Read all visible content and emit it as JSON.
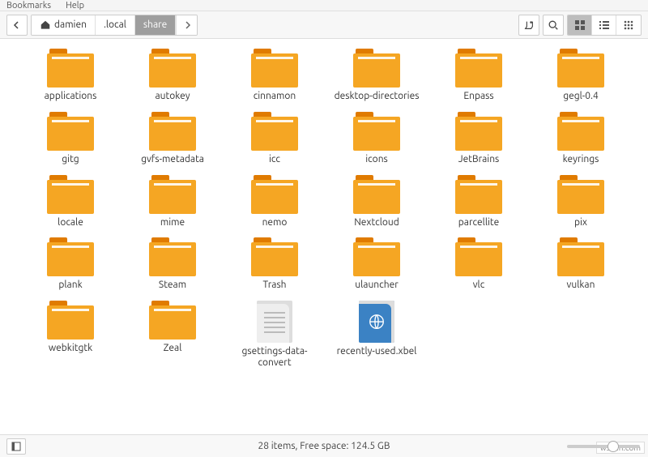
{
  "menubar": {
    "item1": "Bookmarks",
    "item2": "Help"
  },
  "path": {
    "home_label": "damien",
    "seg_local": ".local",
    "seg_share": "share"
  },
  "items": [
    {
      "type": "folder",
      "label": "applications"
    },
    {
      "type": "folder",
      "label": "autokey"
    },
    {
      "type": "folder",
      "label": "cinnamon"
    },
    {
      "type": "folder",
      "label": "desktop-directories"
    },
    {
      "type": "folder",
      "label": "Enpass"
    },
    {
      "type": "folder",
      "label": "gegl-0.4"
    },
    {
      "type": "folder",
      "label": "gitg"
    },
    {
      "type": "folder",
      "label": "gvfs-metadata"
    },
    {
      "type": "folder",
      "label": "icc"
    },
    {
      "type": "folder",
      "label": "icons"
    },
    {
      "type": "folder",
      "label": "JetBrains"
    },
    {
      "type": "folder",
      "label": "keyrings"
    },
    {
      "type": "folder",
      "label": "locale"
    },
    {
      "type": "folder",
      "label": "mime"
    },
    {
      "type": "folder",
      "label": "nemo"
    },
    {
      "type": "folder",
      "label": "Nextcloud"
    },
    {
      "type": "folder",
      "label": "parcellite"
    },
    {
      "type": "folder",
      "label": "pix"
    },
    {
      "type": "folder",
      "label": "plank"
    },
    {
      "type": "folder",
      "label": "Steam"
    },
    {
      "type": "folder",
      "label": "Trash"
    },
    {
      "type": "folder",
      "label": "ulauncher"
    },
    {
      "type": "folder",
      "label": "vlc"
    },
    {
      "type": "folder",
      "label": "vulkan"
    },
    {
      "type": "folder",
      "label": "webkitgtk"
    },
    {
      "type": "folder",
      "label": "Zeal"
    },
    {
      "type": "file-text",
      "label": "gsettings-data-convert"
    },
    {
      "type": "file-globe",
      "label": "recently-used.​xbel"
    }
  ],
  "status": {
    "text": "28 items, Free space: 124.5 GB"
  },
  "watermark": "wsxdn.com"
}
